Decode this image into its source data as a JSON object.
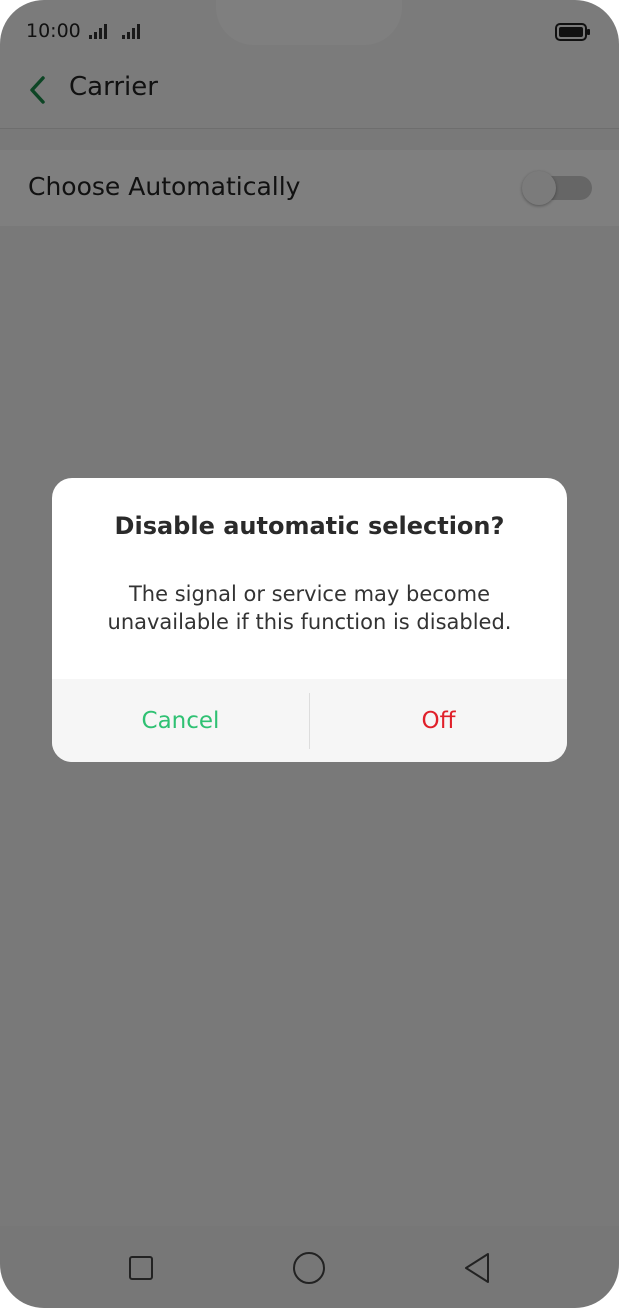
{
  "status_bar": {
    "time": "10:00",
    "icons": [
      "signal-icon",
      "signal-icon",
      "battery-icon"
    ]
  },
  "app_bar": {
    "back_icon": "chevron-left-icon",
    "title": "Carrier"
  },
  "settings": {
    "choose_automatically": {
      "label": "Choose Automatically",
      "enabled": false
    }
  },
  "dialog": {
    "title": "Disable automatic selection?",
    "message": "The signal or service may become unavailable if this function is disabled.",
    "cancel_label": "Cancel",
    "confirm_label": "Off"
  },
  "nav_bar": {
    "icons": [
      "recents-square-icon",
      "home-circle-icon",
      "back-triangle-icon"
    ]
  },
  "colors": {
    "accent_green": "#1a8a4a",
    "cancel_green": "#2fc173",
    "off_red": "#e0202a"
  }
}
